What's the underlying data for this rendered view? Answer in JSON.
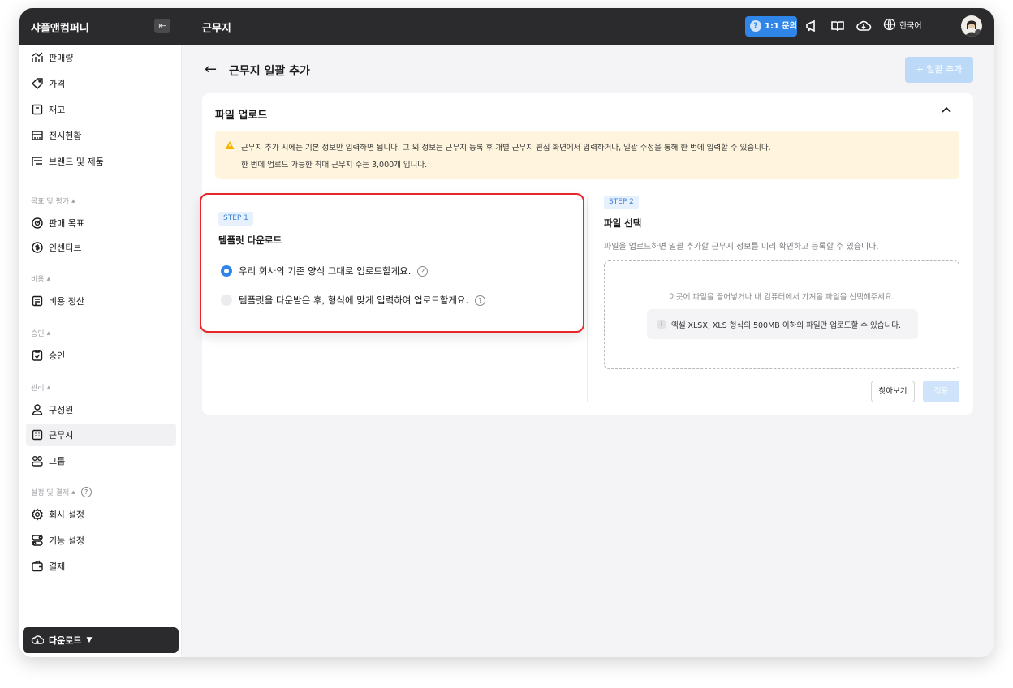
{
  "topbar": {
    "company": "샤플앤컴퍼니",
    "page": "근무지",
    "inquiry": "1:1 문의",
    "language": "한국어"
  },
  "sidebar": {
    "items_top": [
      {
        "label": "판매량",
        "icon": "sales-chart-icon"
      },
      {
        "label": "가격",
        "icon": "price-tag-icon"
      },
      {
        "label": "재고",
        "icon": "inventory-icon"
      },
      {
        "label": "전시현황",
        "icon": "display-status-icon"
      },
      {
        "label": "브랜드 및 제품",
        "icon": "brand-list-icon"
      }
    ],
    "section_goals": "목표 및 평가",
    "items_goals": [
      {
        "label": "판매 목표",
        "icon": "target-icon"
      },
      {
        "label": "인센티브",
        "icon": "incentive-icon"
      }
    ],
    "section_cost": "비용",
    "items_cost": [
      {
        "label": "비용 정산",
        "icon": "receipt-icon"
      }
    ],
    "section_approval": "승인",
    "items_approval": [
      {
        "label": "승인",
        "icon": "approval-icon"
      }
    ],
    "section_manage": "관리",
    "items_manage": [
      {
        "label": "구성원",
        "icon": "person-icon"
      },
      {
        "label": "근무지",
        "icon": "workplace-icon"
      },
      {
        "label": "그룹",
        "icon": "group-icon"
      }
    ],
    "section_settings": "설정 및 결제",
    "items_settings": [
      {
        "label": "회사 설정",
        "icon": "gear-icon"
      },
      {
        "label": "기능 설정",
        "icon": "toggle-icon"
      },
      {
        "label": "결제",
        "icon": "wallet-icon"
      }
    ],
    "download": "다운로드"
  },
  "main": {
    "title": "근무지 일괄 추가",
    "bulk_add": "일괄 추가",
    "card_title": "파일 업로드",
    "notice_line1": "근무지 추가 시에는 기본 정보만 입력하면 됩니다. 그 외 정보는 근무지 등록 후 개별 근무지 편집 화면에서 입력하거나, 일괄 수정을 통해 한 번에 입력할 수 있습니다.",
    "notice_line2": "한 번에 업로드 가능한 최대 근무지 수는 3,000개 입니다.",
    "step1": {
      "tag": "STEP 1",
      "title": "템플릿 다운로드",
      "option1": "우리 회사의 기존 양식 그대로 업로드할게요.",
      "option2": "템플릿을 다운받은 후, 형식에 맞게 입력하여 업로드할게요."
    },
    "step2": {
      "tag": "STEP 2",
      "title": "파일 선택",
      "desc": "파일을 업로드하면 일괄 추가할 근무지 정보를 미리 확인하고 등록할 수 있습니다.",
      "drop_text": "이곳에 파일을 끌어넣거나 내 컴퓨터에서 가져올 파일을 선택해주세요.",
      "info": "엑셀 XLSX, XLS 형식의 500MB 이하의 파일만 업로드할 수 있습니다.",
      "browse": "찾아보기",
      "apply": "적용"
    }
  },
  "colors": {
    "accent": "#2f86e8",
    "highlight": "#e8262b",
    "notice_bg": "#fff5de",
    "topbar_bg": "#2b2b2d"
  }
}
